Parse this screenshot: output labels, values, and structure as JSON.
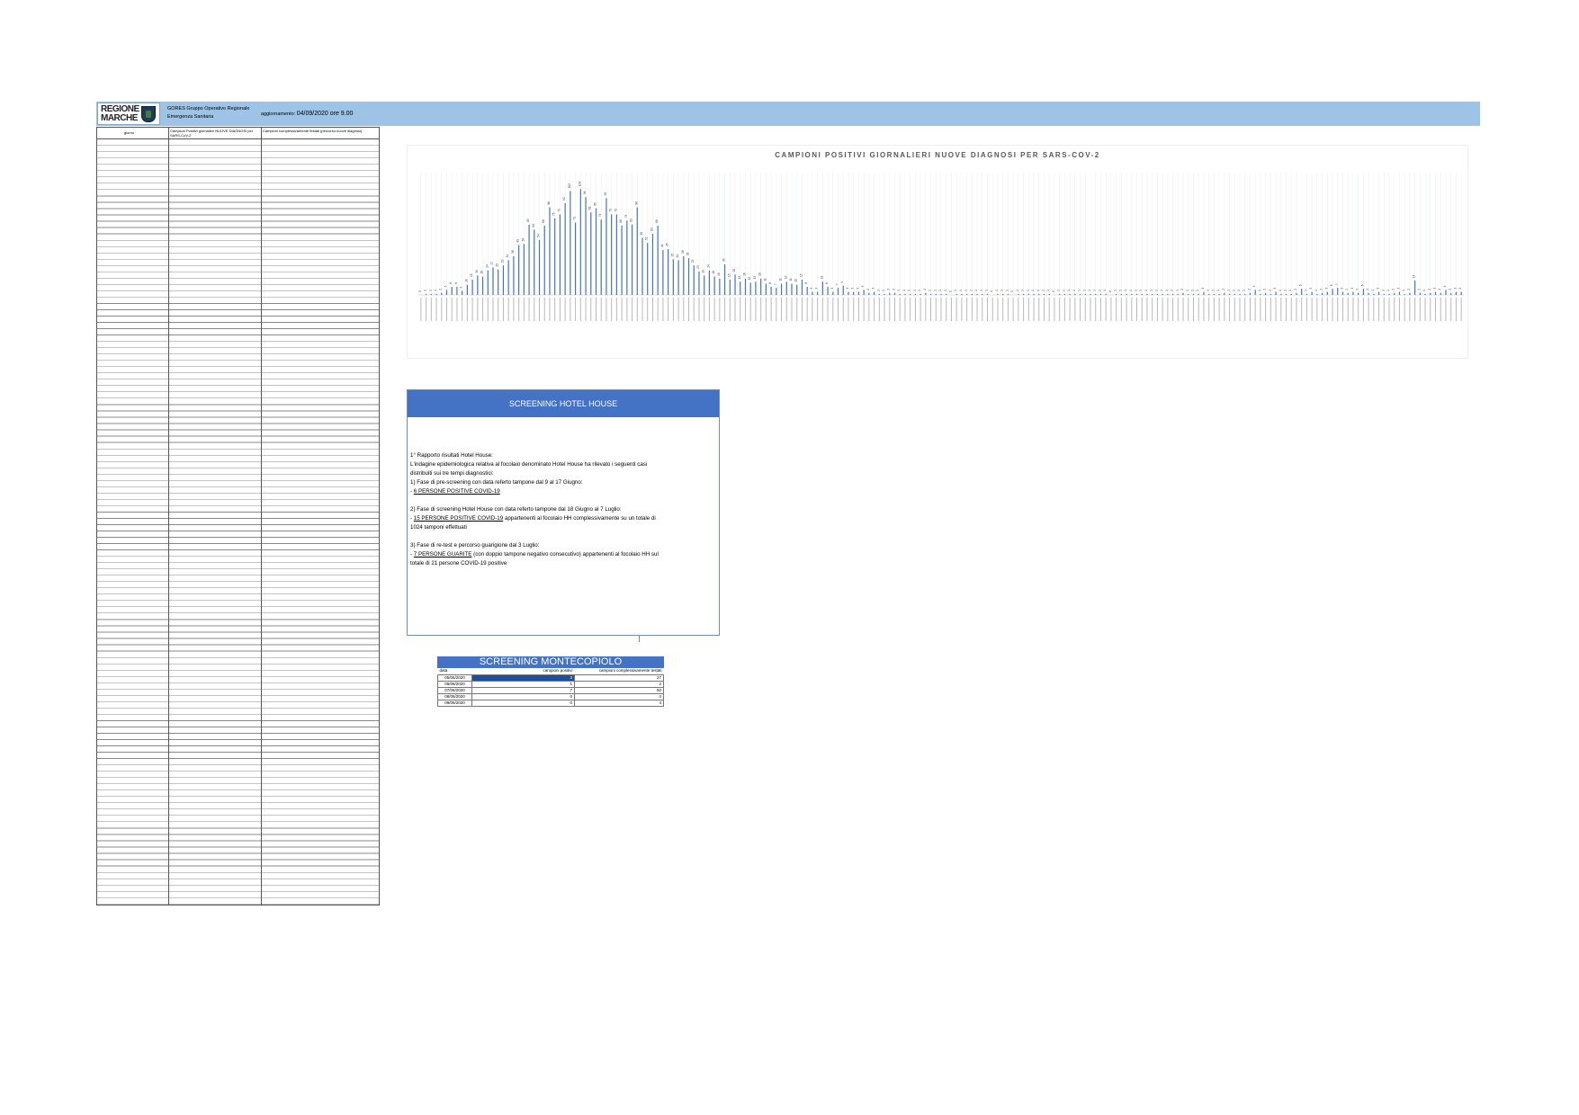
{
  "header": {
    "logo_line1": "REGIONE",
    "logo_line2": "MARCHE",
    "org": "GORES Gruppo Operativo Regionale Emergenza Sanitaria",
    "updated_label": "aggiornamento:",
    "updated_value": "04/09/2020 ore 9.00"
  },
  "left_table": {
    "col1": "giorno",
    "col2": "Campioni Positivi giornalieri NUOVE DIAGNOSI per SARS-CoV-2",
    "col3": "Campioni complessivamente testati (percorso nuove diagnosi)"
  },
  "chart_data": {
    "type": "bar",
    "title": "CAMPIONI POSITIVI GIORNALIERI NUOVE DIAGNOSI PER SARS-COV-2",
    "ylim": [
      0,
      120
    ],
    "grid": true,
    "series": [
      {
        "name": "",
        "color": "#4472c4"
      }
    ],
    "values": [
      0,
      1,
      1,
      1,
      2,
      5,
      8,
      8,
      4,
      10,
      15,
      19,
      18,
      24,
      27,
      25,
      29,
      34,
      38,
      49,
      50,
      69,
      64,
      54,
      68,
      86,
      75,
      79,
      90,
      102,
      71,
      104,
      96,
      81,
      85,
      74,
      95,
      79,
      79,
      68,
      73,
      69,
      86,
      56,
      51,
      60,
      68,
      44,
      45,
      35,
      34,
      38,
      36,
      29,
      23,
      19,
      24,
      18,
      16,
      30,
      15,
      20,
      13,
      16,
      12,
      13,
      16,
      11,
      8,
      7,
      11,
      13,
      11,
      10,
      15,
      8,
      3,
      3,
      13,
      8,
      3,
      7,
      9,
      3,
      3,
      3,
      5,
      2,
      3,
      1,
      1,
      2,
      2,
      1,
      1,
      1,
      1,
      1,
      2,
      1,
      1,
      1,
      1,
      0,
      1,
      1,
      1,
      1,
      1,
      1,
      1,
      0,
      1,
      1,
      1,
      0,
      1,
      1,
      1,
      1,
      1,
      1,
      1,
      0,
      1,
      1,
      1,
      1,
      1,
      1,
      1,
      1,
      1,
      1,
      0,
      1,
      1,
      1,
      1,
      1,
      1,
      1,
      1,
      1,
      1,
      1,
      1,
      1,
      2,
      1,
      1,
      1,
      3,
      1,
      1,
      1,
      2,
      1,
      1,
      1,
      1,
      2,
      5,
      1,
      2,
      1,
      3,
      1,
      1,
      1,
      2,
      6,
      1,
      3,
      1,
      2,
      3,
      6,
      7,
      3,
      2,
      3,
      2,
      6,
      2,
      1,
      3,
      1,
      1,
      2,
      3,
      1,
      2,
      14,
      2,
      1,
      2,
      3,
      2,
      5,
      2,
      3,
      3
    ]
  },
  "hotel": {
    "title": "SCREENING HOTEL HOUSE",
    "l1": "1° Rapporto risultati Hotel House:",
    "l2": "L'indagine epidemiologica relativa al focolaio denominato Hotel House ha rilevato i seguenti casi",
    "l3": "distribuiti sui tre tempi diagnostici:",
    "l4": "1) Fase di pre-screening con data referto tampone dal 9 al 17 Giugno:",
    "l5": "6 PERSONE POSITIVE COVID-19",
    "l6": "2) Fase di screening Hotel House con data referto tampone dal 18 Giugno al 7 Luglio:",
    "l7a": "15 PERSONE POSITIVE COVID-19",
    "l7b": " appartenenti al focolaio HH complessivamente su un totale di",
    "l8": "1024 tamponi effettuati",
    "l9": "3) Fase di re-test e percorso guarigione dal 3 Luglio:",
    "l10a": "7 PERSONE GUARITE",
    "l10b": " (con doppio tampone negativo consecutivo) appartenenti al focolaio HH sul",
    "l11": "totale di 21 persone COVID-19 positive"
  },
  "monte": {
    "title": "SCREENING MONTECOPIOLO",
    "h1": "data",
    "h2": "campioni positivi",
    "h3": "campioni complessivamente testati",
    "rows": [
      {
        "d": "05/06/2020",
        "p": "3",
        "t": "27"
      },
      {
        "d": "06/06/2020",
        "p": "1",
        "t": "2"
      },
      {
        "d": "07/06/2020",
        "p": "7",
        "t": "50"
      },
      {
        "d": "08/06/2020",
        "p": "0",
        "t": "4"
      },
      {
        "d": "09/06/2020",
        "p": "0",
        "t": "4"
      }
    ]
  }
}
